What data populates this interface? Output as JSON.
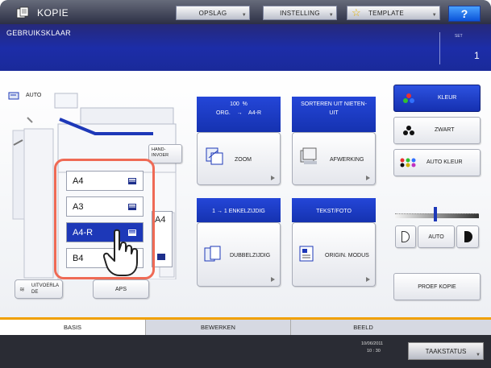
{
  "app": {
    "title": "KOPIE",
    "status": "GEBRUIKSKLAAR",
    "set_label": "SET",
    "copy_count": "1"
  },
  "toolbar": {
    "opslag": "OPSLAG",
    "instelling": "INSTELLING",
    "template": "TEMPLATE",
    "help": "?"
  },
  "left": {
    "auto_label": "AUTO",
    "handinvoer": "HAND-\nINVOER",
    "trays": [
      {
        "label": "A4",
        "selected": false
      },
      {
        "label": "A3",
        "selected": false
      },
      {
        "label": "A4-R",
        "selected": true
      },
      {
        "label": "B4",
        "selected": false
      }
    ],
    "side_tray": "A4",
    "uitvoerlade": "UITVOERLA\nDE",
    "aps": "APS"
  },
  "functions": {
    "zoom_header": "100  %\nORG.    →    A4-R",
    "zoom": "ZOOM",
    "finish_header": "SORTEREN UIT NIETEN-\nUIT",
    "finish": "AFWERKING",
    "duplex_header": "1 → 1 ENKELZIJDIG",
    "duplex": "DUBBELZIJDIG",
    "mode_header": "TEKST/FOTO",
    "mode": "ORIGIN. MODUS"
  },
  "color": {
    "kleur": "KLEUR",
    "zwart": "ZWART",
    "auto_kleur": "AUTO KLEUR",
    "density_auto": "AUTO",
    "density_level": 0.5,
    "proof": "PROEF KOPIE",
    "accent": "#1d38b8"
  },
  "tabs": {
    "basis": "BASIS",
    "bewerken": "BEWERKEN",
    "beeld": "BEELD"
  },
  "footer": {
    "date": "10/06/2011",
    "time": "10 : 30",
    "job_status": "TAAKSTATUS"
  }
}
